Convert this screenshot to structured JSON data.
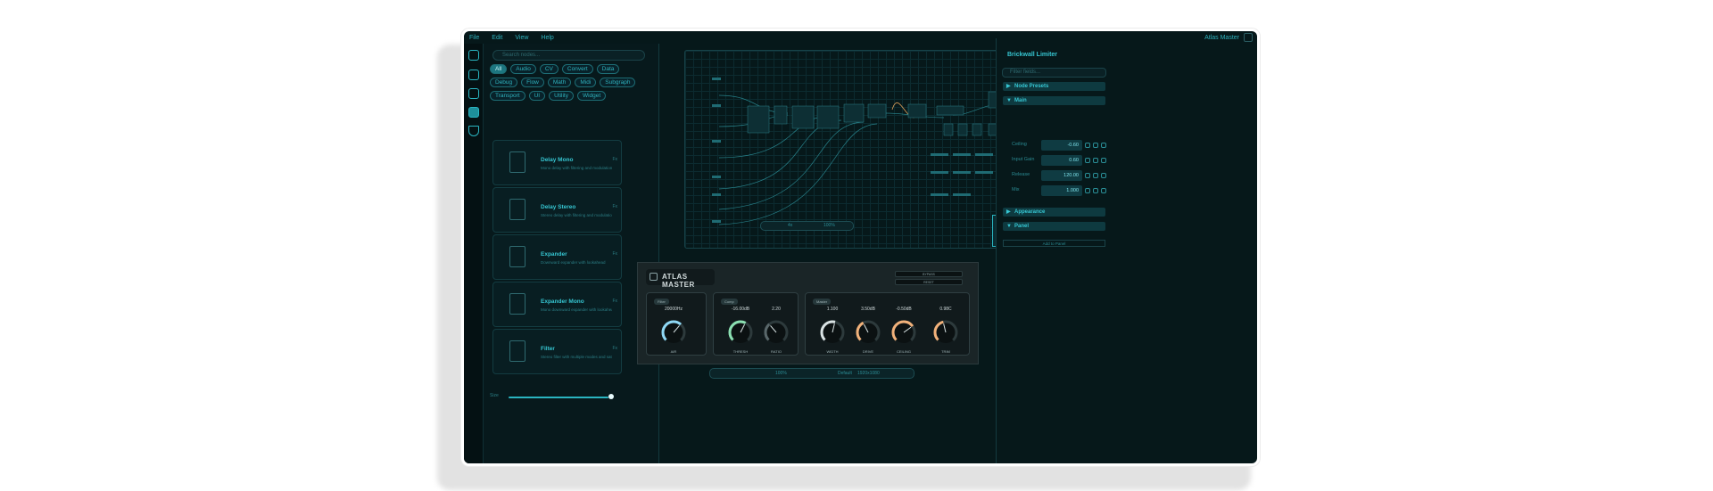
{
  "menu": [
    "File",
    "Edit",
    "View",
    "Help"
  ],
  "project_name": "Atlas Master",
  "library": {
    "search_placeholder": "Search nodes...",
    "categories": [
      {
        "label": "All",
        "active": true
      },
      {
        "label": "Audio"
      },
      {
        "label": "CV"
      },
      {
        "label": "Convert"
      },
      {
        "label": "Data"
      },
      {
        "label": "Debug"
      },
      {
        "label": "Flow"
      },
      {
        "label": "Math"
      },
      {
        "label": "Midi"
      },
      {
        "label": "Subgraph"
      },
      {
        "label": "Transport"
      },
      {
        "label": "UI"
      },
      {
        "label": "Utility"
      },
      {
        "label": "Widget"
      }
    ],
    "nodes": [
      {
        "title": "Delay Mono",
        "desc": "Mono delay with filtering and modulation",
        "tag": "Fx"
      },
      {
        "title": "Delay Stereo",
        "desc": "Stereo delay with filtering and modulation",
        "tag": "Fx"
      },
      {
        "title": "Expander",
        "desc": "Downward expander with lookahead",
        "tag": "Fx"
      },
      {
        "title": "Expander Mono",
        "desc": "Mono downward expander with lookahead",
        "tag": "Fx"
      },
      {
        "title": "Filter",
        "desc": "Stereo filter with multiple modes and saturation",
        "tag": "Fx"
      }
    ],
    "size_label": "Size"
  },
  "canvas_toolbar": {
    "zoom": "100%",
    "stepper": "4x"
  },
  "inspector": {
    "title": "Brickwall Limiter",
    "filter_placeholder": "Filter fields...",
    "sections": {
      "presets": "Node Presets",
      "main": "Main",
      "appearance": "Appearance",
      "panel": "Panel"
    },
    "fields": [
      {
        "label": "Ceiling",
        "value": "-0.60"
      },
      {
        "label": "Input Gain",
        "value": "0.60"
      },
      {
        "label": "Release",
        "value": "120.00"
      },
      {
        "label": "Mix",
        "value": "1.000"
      }
    ],
    "add_to_panel": "Add to Panel"
  },
  "atlas": {
    "name": "ATLAS MASTER",
    "buttons": [
      "BYPASS",
      "RESET"
    ],
    "groups": [
      {
        "tag": "Filter",
        "knobs": [
          {
            "value": "20000Hz",
            "label": "AIR",
            "color": "#8fd8f5",
            "level": 0.65
          }
        ]
      },
      {
        "tag": "Comp",
        "knobs": [
          {
            "value": "-16.00dB",
            "label": "THRESH",
            "color": "#8be0b2",
            "level": 0.6
          },
          {
            "value": "2.20",
            "label": "RATIO",
            "color": "#59676a",
            "level": 0.35
          }
        ]
      },
      {
        "tag": "Master",
        "knobs": [
          {
            "value": "1.100",
            "label": "WIDTH",
            "color": "#d9e2e3",
            "level": 0.55
          },
          {
            "value": "3.50dB",
            "label": "DRIVE",
            "color": "#f1b17a",
            "level": 0.4
          },
          {
            "value": "-0.50dB",
            "label": "CEILING",
            "color": "#f1b17a",
            "level": 0.7
          },
          {
            "value": "0.98C",
            "label": "TRIM",
            "color": "#f1b17a",
            "level": 0.45
          }
        ]
      }
    ]
  },
  "bottom_toolbar": {
    "zoom": "100%",
    "preset": "Default",
    "size": "1920x1080"
  },
  "colors": {
    "accent": "#2ab5c1",
    "background": "#06181a"
  }
}
